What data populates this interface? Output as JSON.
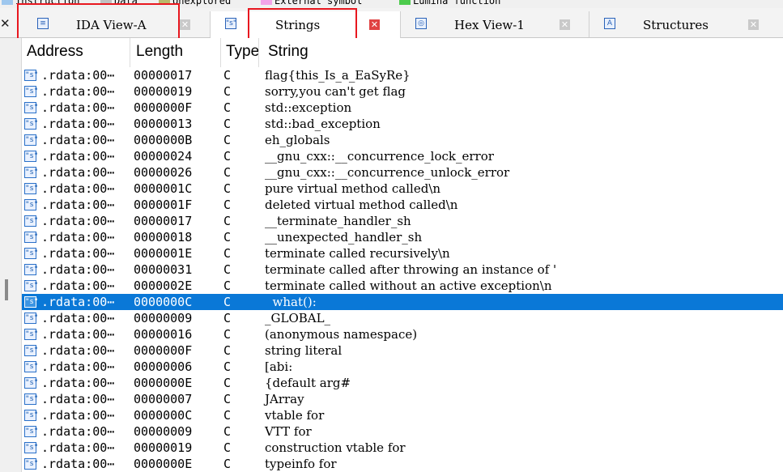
{
  "legend": [
    {
      "label": "Instruction",
      "color": "#9ec7ee"
    },
    {
      "label": "Data",
      "color": "#c0c0c0"
    },
    {
      "label": "Unexplored",
      "color": "#b9b96a"
    },
    {
      "label": "External symbol",
      "color": "#f2a3e8"
    },
    {
      "label": "Lumina function",
      "color": "#4ccb4c"
    }
  ],
  "tabbar": {
    "close_all": "✕",
    "tabs": [
      {
        "label": "IDA View-A",
        "icon": "disassembly-icon",
        "active": false
      },
      {
        "label": "Strings",
        "icon": "strings-icon",
        "active": true
      },
      {
        "label": "Hex View-1",
        "icon": "hex-icon",
        "active": false
      },
      {
        "label": "Structures",
        "icon": "structures-icon",
        "active": false
      }
    ]
  },
  "table": {
    "columns": [
      "Address",
      "Length",
      "Type",
      "String"
    ],
    "selected_index": 14,
    "rows": [
      {
        "address": ".rdata:00⋯",
        "length": "00000017",
        "type": "C",
        "string": "flag{this_Is_a_EaSyRe}"
      },
      {
        "address": ".rdata:00⋯",
        "length": "00000019",
        "type": "C",
        "string": "sorry,you can't get flag"
      },
      {
        "address": ".rdata:00⋯",
        "length": "0000000F",
        "type": "C",
        "string": "std::exception"
      },
      {
        "address": ".rdata:00⋯",
        "length": "00000013",
        "type": "C",
        "string": "std::bad_exception"
      },
      {
        "address": ".rdata:00⋯",
        "length": "0000000B",
        "type": "C",
        "string": "eh_globals"
      },
      {
        "address": ".rdata:00⋯",
        "length": "00000024",
        "type": "C",
        "string": "__gnu_cxx::__concurrence_lock_error"
      },
      {
        "address": ".rdata:00⋯",
        "length": "00000026",
        "type": "C",
        "string": "__gnu_cxx::__concurrence_unlock_error"
      },
      {
        "address": ".rdata:00⋯",
        "length": "0000001C",
        "type": "C",
        "string": "pure virtual method called\\n"
      },
      {
        "address": ".rdata:00⋯",
        "length": "0000001F",
        "type": "C",
        "string": "deleted virtual method called\\n"
      },
      {
        "address": ".rdata:00⋯",
        "length": "00000017",
        "type": "C",
        "string": "__terminate_handler_sh"
      },
      {
        "address": ".rdata:00⋯",
        "length": "00000018",
        "type": "C",
        "string": "__unexpected_handler_sh"
      },
      {
        "address": ".rdata:00⋯",
        "length": "0000001E",
        "type": "C",
        "string": "terminate called recursively\\n"
      },
      {
        "address": ".rdata:00⋯",
        "length": "00000031",
        "type": "C",
        "string": "terminate called after throwing an instance of '"
      },
      {
        "address": ".rdata:00⋯",
        "length": "0000002E",
        "type": "C",
        "string": "terminate called without an active exception\\n"
      },
      {
        "address": ".rdata:00⋯",
        "length": "0000000C",
        "type": "C",
        "string": "  what():"
      },
      {
        "address": ".rdata:00⋯",
        "length": "00000009",
        "type": "C",
        "string": "_GLOBAL_"
      },
      {
        "address": ".rdata:00⋯",
        "length": "00000016",
        "type": "C",
        "string": "(anonymous namespace)"
      },
      {
        "address": ".rdata:00⋯",
        "length": "0000000F",
        "type": "C",
        "string": "string literal"
      },
      {
        "address": ".rdata:00⋯",
        "length": "00000006",
        "type": "C",
        "string": "[abi:"
      },
      {
        "address": ".rdata:00⋯",
        "length": "0000000E",
        "type": "C",
        "string": "{default arg#"
      },
      {
        "address": ".rdata:00⋯",
        "length": "00000007",
        "type": "C",
        "string": "JArray"
      },
      {
        "address": ".rdata:00⋯",
        "length": "0000000C",
        "type": "C",
        "string": "vtable for"
      },
      {
        "address": ".rdata:00⋯",
        "length": "00000009",
        "type": "C",
        "string": "VTT for"
      },
      {
        "address": ".rdata:00⋯",
        "length": "00000019",
        "type": "C",
        "string": "construction vtable for"
      },
      {
        "address": ".rdata:00⋯",
        "length": "0000000E",
        "type": "C",
        "string": "typeinfo for"
      }
    ]
  }
}
